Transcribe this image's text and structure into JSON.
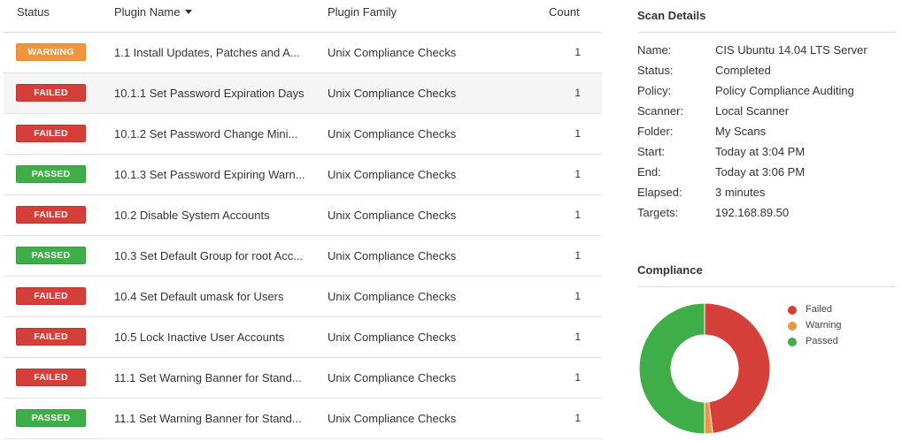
{
  "table": {
    "headers": {
      "status": "Status",
      "name": "Plugin Name",
      "family": "Plugin Family",
      "count": "Count"
    },
    "rows": [
      {
        "status": "WARNING",
        "name": "1.1 Install Updates, Patches and A...",
        "family": "Unix Compliance Checks",
        "count": "1"
      },
      {
        "status": "FAILED",
        "name": "10.1.1 Set Password Expiration Days",
        "family": "Unix Compliance Checks",
        "count": "1"
      },
      {
        "status": "FAILED",
        "name": "10.1.2 Set Password Change Mini...",
        "family": "Unix Compliance Checks",
        "count": "1"
      },
      {
        "status": "PASSED",
        "name": "10.1.3 Set Password Expiring Warn...",
        "family": "Unix Compliance Checks",
        "count": "1"
      },
      {
        "status": "FAILED",
        "name": "10.2 Disable System Accounts",
        "family": "Unix Compliance Checks",
        "count": "1"
      },
      {
        "status": "PASSED",
        "name": "10.3 Set Default Group for root Acc...",
        "family": "Unix Compliance Checks",
        "count": "1"
      },
      {
        "status": "FAILED",
        "name": "10.4 Set Default umask for Users",
        "family": "Unix Compliance Checks",
        "count": "1"
      },
      {
        "status": "FAILED",
        "name": "10.5 Lock Inactive User Accounts",
        "family": "Unix Compliance Checks",
        "count": "1"
      },
      {
        "status": "FAILED",
        "name": "11.1 Set Warning Banner for Stand...",
        "family": "Unix Compliance Checks",
        "count": "1"
      },
      {
        "status": "PASSED",
        "name": "11.1 Set Warning Banner for Stand...",
        "family": "Unix Compliance Checks",
        "count": "1"
      }
    ]
  },
  "scan_details": {
    "title": "Scan Details",
    "items": [
      {
        "label": "Name:",
        "value": "CIS Ubuntu 14.04 LTS Server"
      },
      {
        "label": "Status:",
        "value": "Completed"
      },
      {
        "label": "Policy:",
        "value": "Policy Compliance Auditing"
      },
      {
        "label": "Scanner:",
        "value": "Local Scanner"
      },
      {
        "label": "Folder:",
        "value": "My Scans"
      },
      {
        "label": "Start:",
        "value": "Today at 3:04 PM"
      },
      {
        "label": "End:",
        "value": "Today at 3:06 PM"
      },
      {
        "label": "Elapsed:",
        "value": "3 minutes"
      },
      {
        "label": "Targets:",
        "value": "192.168.89.50"
      }
    ]
  },
  "compliance": {
    "title": "Compliance",
    "legend": [
      {
        "label": "Failed",
        "color": "#d43f3a"
      },
      {
        "label": "Warning",
        "color": "#f0953f"
      },
      {
        "label": "Passed",
        "color": "#3fae49"
      }
    ],
    "chart_data": {
      "type": "pie",
      "categories": [
        "Failed",
        "Warning",
        "Passed"
      ],
      "values": [
        48,
        2,
        50
      ],
      "colors": [
        "#d43f3a",
        "#f0953f",
        "#3fae49"
      ]
    }
  },
  "colors": {
    "warning": "#f0953f",
    "failed": "#d43f3a",
    "passed": "#3fae49"
  }
}
